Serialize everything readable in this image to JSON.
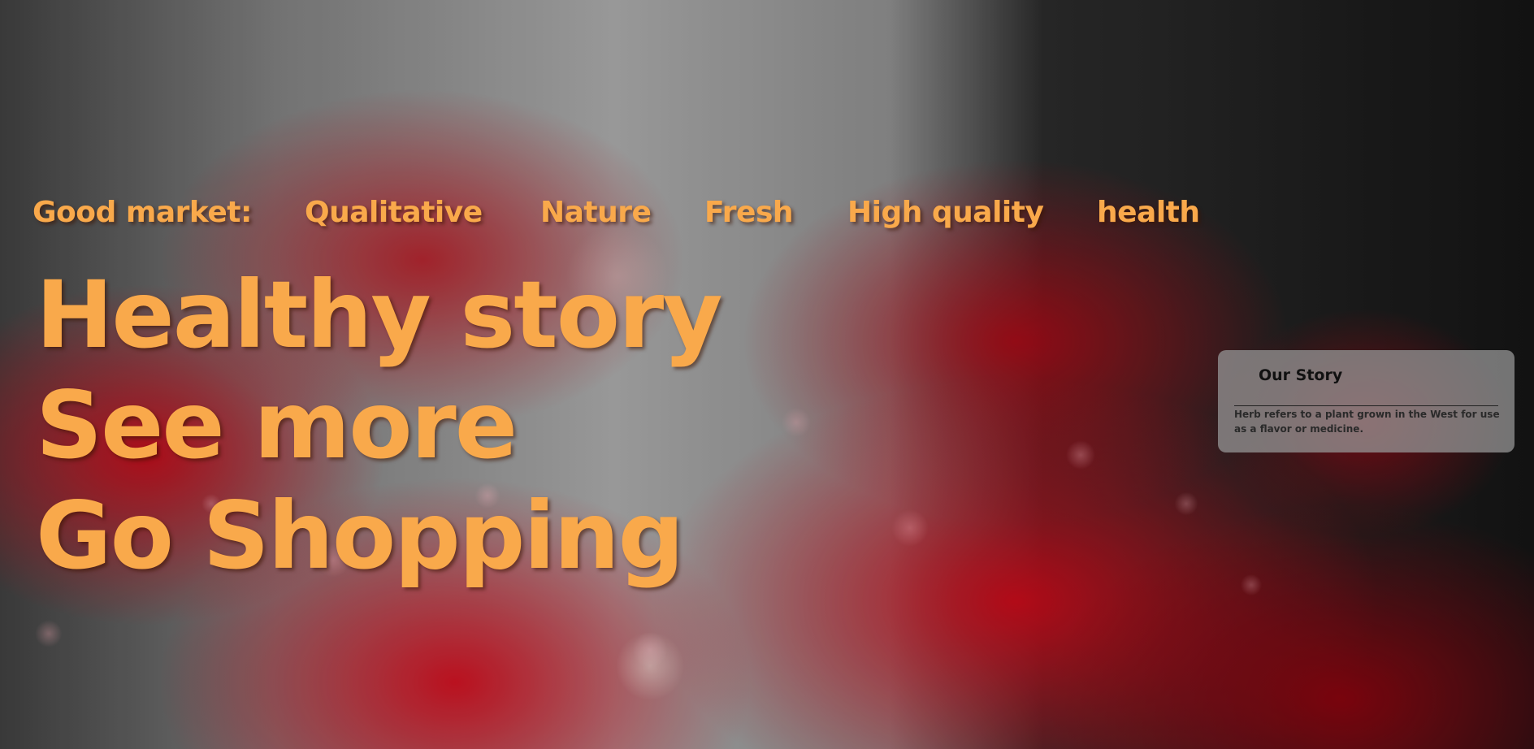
{
  "colors": {
    "accent": "#f9a94b",
    "card_background": "#969696",
    "card_text": "#111111"
  },
  "topbar": {
    "items": [
      {
        "label": "Good market:"
      },
      {
        "label": "Qualitative"
      },
      {
        "label": "Nature"
      },
      {
        "label": "Fresh"
      },
      {
        "label": "High quality"
      },
      {
        "label": "health"
      }
    ]
  },
  "hero": {
    "lines": [
      {
        "text": "Healthy story"
      },
      {
        "text": "See more"
      },
      {
        "text": "Go Shopping"
      }
    ]
  },
  "story_card": {
    "title": "Our Story",
    "body": "Herb refers to a plant grown in the West for use as a flavor or medicine."
  }
}
